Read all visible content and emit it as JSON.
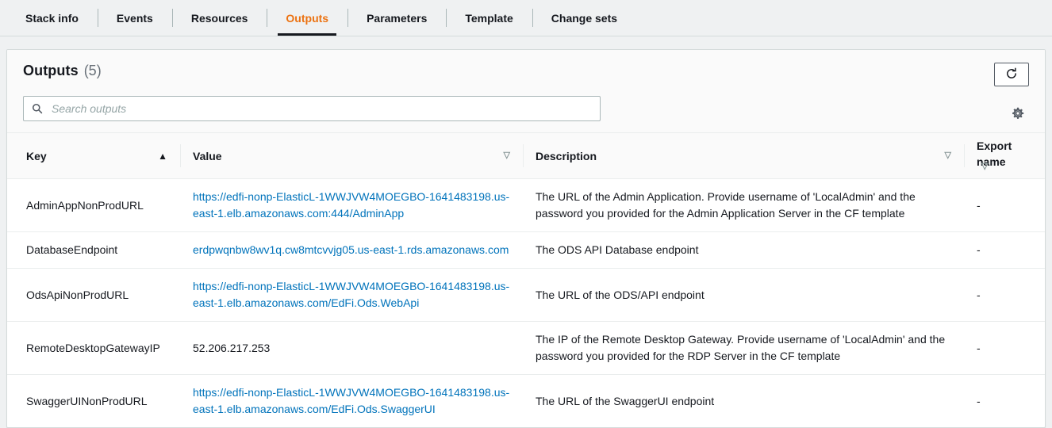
{
  "tabs": [
    {
      "label": "Stack info",
      "active": false
    },
    {
      "label": "Events",
      "active": false
    },
    {
      "label": "Resources",
      "active": false
    },
    {
      "label": "Outputs",
      "active": true
    },
    {
      "label": "Parameters",
      "active": false
    },
    {
      "label": "Template",
      "active": false
    },
    {
      "label": "Change sets",
      "active": false
    }
  ],
  "panel": {
    "title": "Outputs",
    "count": "(5)",
    "refresh_icon": "refresh-icon",
    "settings_icon": "gear-icon"
  },
  "search": {
    "placeholder": "Search outputs",
    "value": "",
    "icon": "search-icon"
  },
  "table": {
    "columns": [
      {
        "label": "Key",
        "sort": "ascending",
        "sort_glyph": "▲",
        "active_sort": true
      },
      {
        "label": "Value",
        "sort": "none",
        "sort_glyph": "▽",
        "active_sort": false
      },
      {
        "label": "Description",
        "sort": "none",
        "sort_glyph": "▽",
        "active_sort": false
      },
      {
        "label": "Export name",
        "sort": "none",
        "sort_glyph": "▽",
        "active_sort": false
      }
    ],
    "rows": [
      {
        "key": "AdminAppNonProdURL",
        "value": "https://edfi-nonp-ElasticL-1WWJVW4MOEGBO-1641483198.us-east-1.elb.amazonaws.com:444/AdminApp",
        "value_is_link": true,
        "description": "The URL of the Admin Application. Provide username of 'LocalAdmin' and the password you provided for the Admin Application Server in the CF template",
        "export_name": "-"
      },
      {
        "key": "DatabaseEndpoint",
        "value": "erdpwqnbw8wv1q.cw8mtcvvjg05.us-east-1.rds.amazonaws.com",
        "value_is_link": true,
        "description": "The ODS API Database endpoint",
        "export_name": "-"
      },
      {
        "key": "OdsApiNonProdURL",
        "value": "https://edfi-nonp-ElasticL-1WWJVW4MOEGBO-1641483198.us-east-1.elb.amazonaws.com/EdFi.Ods.WebApi",
        "value_is_link": true,
        "description": "The URL of the ODS/API endpoint",
        "export_name": "-"
      },
      {
        "key": "RemoteDesktopGatewayIP",
        "value": "52.206.217.253",
        "value_is_link": false,
        "description": "The IP of the Remote Desktop Gateway. Provide username of 'LocalAdmin' and the password you provided for the RDP Server in the CF template",
        "export_name": "-"
      },
      {
        "key": "SwaggerUINonProdURL",
        "value": "https://edfi-nonp-ElasticL-1WWJVW4MOEGBO-1641483198.us-east-1.elb.amazonaws.com/EdFi.Ods.SwaggerUI",
        "value_is_link": true,
        "description": "The URL of the SwaggerUI endpoint",
        "export_name": "-"
      }
    ]
  },
  "colors": {
    "accent_orange": "#ec7211",
    "link_blue": "#0073bb",
    "text_dark": "#16191f",
    "muted": "#687078",
    "border": "#eaeded",
    "page_bg": "#eff1f2"
  }
}
